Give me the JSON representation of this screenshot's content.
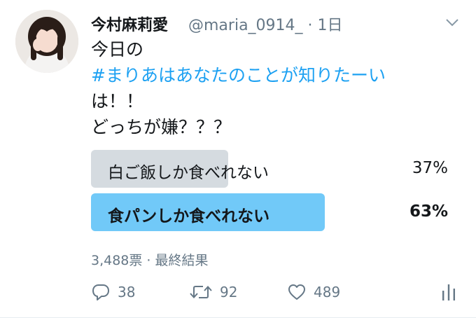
{
  "tweet": {
    "display_name": "今村麻莉愛",
    "meta": "@maria_0914_ · 1日",
    "text": {
      "line1": "今日の",
      "hashtag": "#まりあはあなたのことが知りたーい",
      "line3": "は！！",
      "line4": "どっちが嫌？？？"
    }
  },
  "poll": {
    "options": [
      {
        "label": "白ご飯しか食べれない",
        "percent_text": "37%",
        "percent": 37,
        "color": "#d5dbe0"
      },
      {
        "label": "食パンしか食べれない",
        "percent_text": "63%",
        "percent": 63,
        "color": "#71c9f8"
      }
    ],
    "summary": "3,488票 · 最終結果"
  },
  "actions": {
    "reply_count": "38",
    "retweet_count": "92",
    "like_count": "489"
  },
  "icons": {
    "caret": "chevron-down-icon",
    "reply": "reply-icon",
    "retweet": "retweet-icon",
    "like": "heart-icon",
    "stats": "analytics-icon"
  },
  "colors": {
    "accent": "#1da1f2",
    "secondary_text": "#657786",
    "winning_bar": "#71c9f8",
    "losing_bar": "#d5dbe0"
  }
}
